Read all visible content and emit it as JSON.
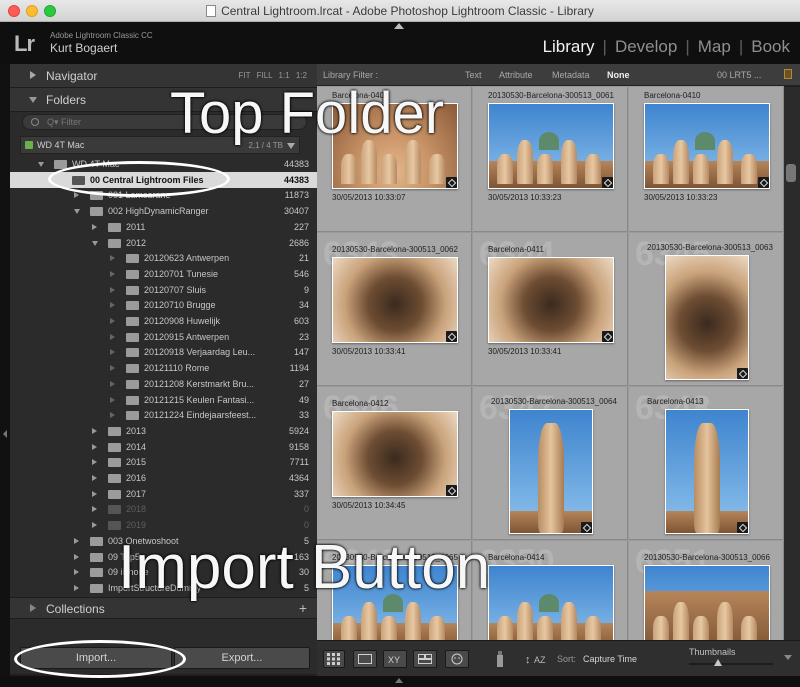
{
  "window": {
    "title": "Central Lightroom.lrcat - Adobe Photoshop Lightroom Classic - Library"
  },
  "identity": {
    "logo": "Lr",
    "app": "Adobe Lightroom Classic CC",
    "user": "Kurt Bogaert"
  },
  "modules": {
    "library": "Library",
    "develop": "Develop",
    "map": "Map",
    "book": "Book",
    "active": "Library",
    "sep": "|"
  },
  "navigator": {
    "label": "Navigator",
    "options": "FIT  FILL  1:1  1:2"
  },
  "folders": {
    "label": "Folders",
    "search_placeholder": "Q▾ Filter",
    "volume": {
      "name": "WD 4T Mac",
      "size": "2,1 / 4 TB"
    },
    "rows": [
      {
        "name": "WD 4T Mac",
        "count": "44383",
        "indent": 44,
        "tri": "down",
        "style": ""
      },
      {
        "name": "00 Central Lightroom Files",
        "count": "44383",
        "indent": 62,
        "tri": "none",
        "style": "sel"
      },
      {
        "name": "001 Lamsarane",
        "count": "11873",
        "indent": 80,
        "tri": "right",
        "style": ""
      },
      {
        "name": "002 HighDynamicRanger",
        "count": "30407",
        "indent": 80,
        "tri": "down",
        "style": ""
      },
      {
        "name": "2011",
        "count": "227",
        "indent": 98,
        "tri": "right",
        "style": ""
      },
      {
        "name": "2012",
        "count": "2686",
        "indent": 98,
        "tri": "down",
        "style": ""
      },
      {
        "name": "20120623 Antwerpen",
        "count": "21",
        "indent": 116,
        "tri": "off",
        "style": ""
      },
      {
        "name": "20120701 Tunesie",
        "count": "546",
        "indent": 116,
        "tri": "off",
        "style": ""
      },
      {
        "name": "20120707 Sluis",
        "count": "9",
        "indent": 116,
        "tri": "off",
        "style": ""
      },
      {
        "name": "20120710 Brugge",
        "count": "34",
        "indent": 116,
        "tri": "off",
        "style": ""
      },
      {
        "name": "20120908 Huwelijk",
        "count": "603",
        "indent": 116,
        "tri": "off",
        "style": ""
      },
      {
        "name": "20120915 Antwerpen",
        "count": "23",
        "indent": 116,
        "tri": "off",
        "style": ""
      },
      {
        "name": "20120918 Verjaardag Leu...",
        "count": "147",
        "indent": 116,
        "tri": "off",
        "style": ""
      },
      {
        "name": "20121110 Rome",
        "count": "1194",
        "indent": 116,
        "tri": "off",
        "style": ""
      },
      {
        "name": "20121208 Kerstmarkt Bru...",
        "count": "27",
        "indent": 116,
        "tri": "off",
        "style": ""
      },
      {
        "name": "20121215 Keulen Fantasi...",
        "count": "49",
        "indent": 116,
        "tri": "off",
        "style": ""
      },
      {
        "name": "20121224 Eindejaarsfeest...",
        "count": "33",
        "indent": 116,
        "tri": "off",
        "style": ""
      },
      {
        "name": "2013",
        "count": "5924",
        "indent": 98,
        "tri": "right",
        "style": ""
      },
      {
        "name": "2014",
        "count": "9158",
        "indent": 98,
        "tri": "right",
        "style": ""
      },
      {
        "name": "2015",
        "count": "7711",
        "indent": 98,
        "tri": "right",
        "style": ""
      },
      {
        "name": "2016",
        "count": "4364",
        "indent": 98,
        "tri": "right",
        "style": ""
      },
      {
        "name": "2017",
        "count": "337",
        "indent": 98,
        "tri": "right",
        "style": ""
      },
      {
        "name": "2018",
        "count": "0",
        "indent": 98,
        "tri": "right",
        "style": "dim"
      },
      {
        "name": "2019",
        "count": "0",
        "indent": 98,
        "tri": "right",
        "style": "dim"
      },
      {
        "name": "003 Onetwoshoot",
        "count": "5",
        "indent": 80,
        "tri": "right",
        "style": ""
      },
      {
        "name": "09 Top5o",
        "count": "163",
        "indent": 80,
        "tri": "right",
        "style": ""
      },
      {
        "name": "09 iPhone",
        "count": "30",
        "indent": 80,
        "tri": "right",
        "style": ""
      },
      {
        "name": "ImportStructureDummy",
        "count": "5",
        "indent": 80,
        "tri": "right",
        "style": ""
      }
    ]
  },
  "collections": {
    "label": "Collections",
    "add": "+"
  },
  "buttons": {
    "import": "Import...",
    "export": "Export..."
  },
  "filterbar": {
    "label": "Library Filter :",
    "items": [
      "Text",
      "Attribute",
      "Metadata",
      "None"
    ],
    "active": "None",
    "preset": "00 LRT5 ..."
  },
  "grid": {
    "cells": [
      {
        "num": "",
        "name": "Barcelona-0409",
        "date": "30/05/2013 10:33:07",
        "kind": "roof"
      },
      {
        "num": "",
        "name": "20130530-Barcelona-300513_0061",
        "date": "30/05/2013 10:33:23",
        "kind": "sky"
      },
      {
        "num": "",
        "name": "Barcelona-0410",
        "date": "30/05/2013 10:33:23",
        "kind": "sky"
      },
      {
        "num": "6343",
        "name": "20130530-Barcelona-300513_0062",
        "date": "30/05/2013 10:33:41",
        "kind": "court"
      },
      {
        "num": "6344",
        "name": "Barcelona-0411",
        "date": "30/05/2013 10:33:41",
        "kind": "court"
      },
      {
        "num": "6345",
        "name": "20130530-Barcelona-300513_0063",
        "date": "30/05/2013 10:34:45",
        "kind": "court-portrait"
      },
      {
        "num": "6346",
        "name": "Barcelona-0412",
        "date": "30/05/2013 10:34:45",
        "kind": "court"
      },
      {
        "num": "6347",
        "name": "20130530-Barcelona-300513_0064",
        "date": "30/05/2013 10:36:09",
        "kind": "tower"
      },
      {
        "num": "6348",
        "name": "Barcelona-0413",
        "date": "30/05/2013 10:36:09",
        "kind": "tower"
      },
      {
        "num": "6349",
        "name": "20130530-Barcelona-300513_0065",
        "date": "",
        "kind": "sky"
      },
      {
        "num": "6350",
        "name": "Barcelona-0414",
        "date": "",
        "kind": "sky"
      },
      {
        "num": "6351",
        "name": "20130530-Barcelona-300513_0066",
        "date": "",
        "kind": "roofscape"
      }
    ]
  },
  "toolbar": {
    "sort_label": "Sort:",
    "sort_value": "Capture Time",
    "thumbnails_label": "Thumbnails",
    "thumbnail_size": 0.35
  },
  "annotations": {
    "top_folder": "Top Folder",
    "import_button": "Import Button",
    "color": "#ffffff"
  },
  "colors": {
    "selected_folder": "#dadada",
    "grid_bg": "#a7a7a7",
    "active_module": "#f2f2f2"
  }
}
